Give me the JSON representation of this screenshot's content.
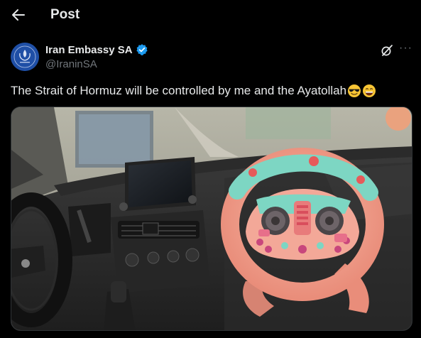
{
  "header": {
    "title": "Post",
    "back_icon": "arrow-left-icon"
  },
  "post": {
    "author": {
      "name": "Iran Embassy SA",
      "handle": "@IraninSA",
      "verified": true,
      "avatar_icon": "embassy-emblem"
    },
    "actions": {
      "grok_icon": "grok-icon",
      "more_icon": "more-icon",
      "more_label": "···"
    },
    "text": "The Strait of Hormuz will be controlled by me and the Ayatollah",
    "emojis": [
      "smiling-face-with-sunglasses-icon",
      "grinning-face-icon"
    ],
    "media": {
      "description_icon": "toy-steering-wheel-in-car-photo"
    }
  },
  "colors": {
    "background": "#000000",
    "text": "#e7e9ea",
    "secondary_text": "#71767b",
    "verified_blue": "#1d9bf0",
    "toy_pink": "#f0a08e",
    "toy_teal": "#7dd6c3"
  }
}
